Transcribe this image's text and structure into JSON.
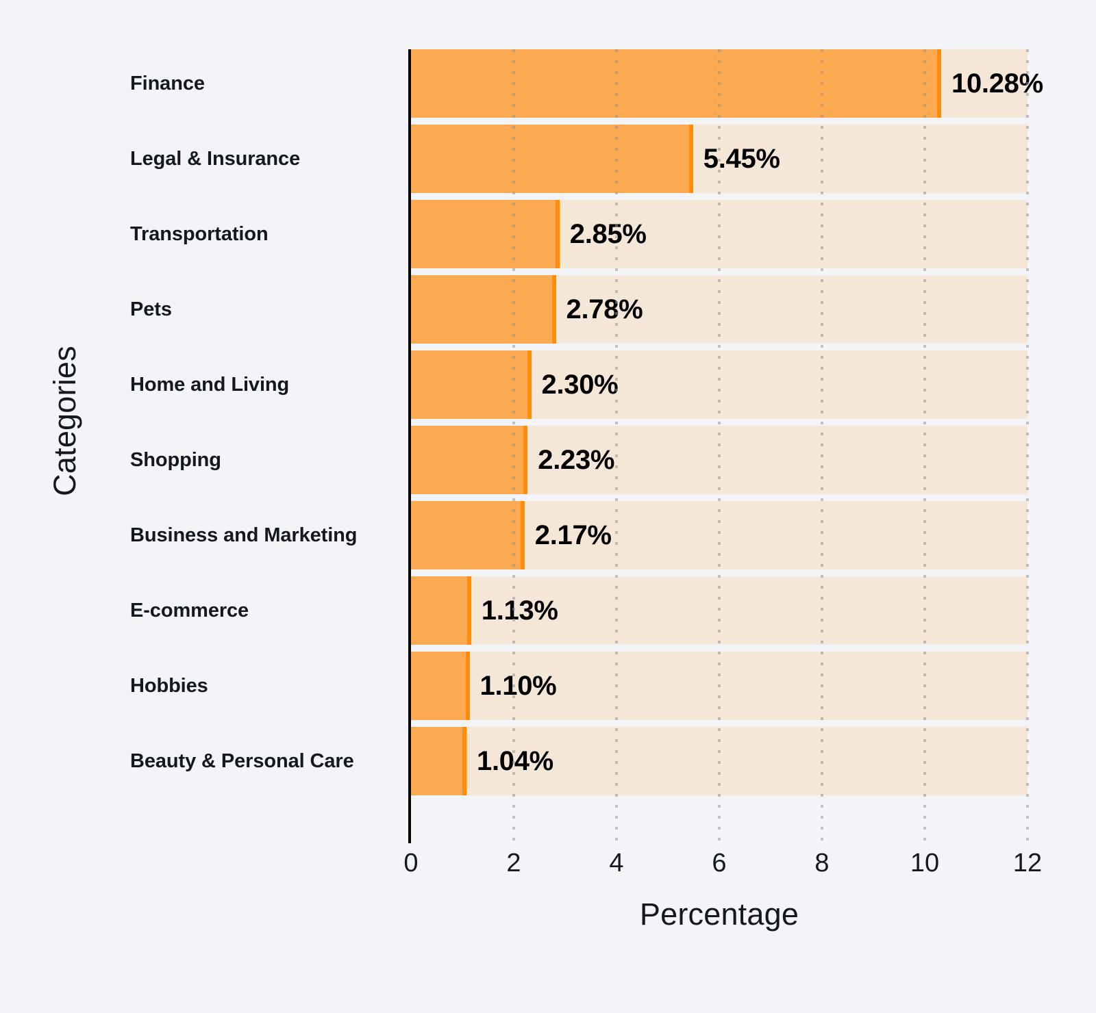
{
  "chart_data": {
    "type": "bar",
    "orientation": "horizontal",
    "title": "",
    "xlabel": "Percentage",
    "ylabel": "Categories",
    "xlim": [
      0,
      12
    ],
    "xticks": [
      "0",
      "2",
      "4",
      "6",
      "8",
      "10",
      "12"
    ],
    "grid": "vertical-dotted",
    "legend": "none",
    "value_suffix": "%",
    "categories": [
      "Finance",
      "Legal & Insurance",
      "Transportation",
      "Pets",
      "Home and Living",
      "Shopping",
      "Business and Marketing",
      "E-commerce",
      "Hobbies",
      "Beauty & Personal Care"
    ],
    "values": [
      10.28,
      5.45,
      2.85,
      2.78,
      2.3,
      2.23,
      2.17,
      1.13,
      1.1,
      1.04
    ],
    "value_labels": [
      "10.28%",
      "5.45%",
      "2.85%",
      "2.78%",
      "2.30%",
      "2.23%",
      "2.17%",
      "1.13%",
      "1.10%",
      "1.04%"
    ],
    "colors": {
      "background": "#f2f4f7",
      "bar_fill": "#fbaa51",
      "bar_edge": "#ff8c0a",
      "track": "#f5e7d8",
      "axis": "#000000",
      "text": "#14181f",
      "gridline": "#9a9a9a"
    }
  }
}
